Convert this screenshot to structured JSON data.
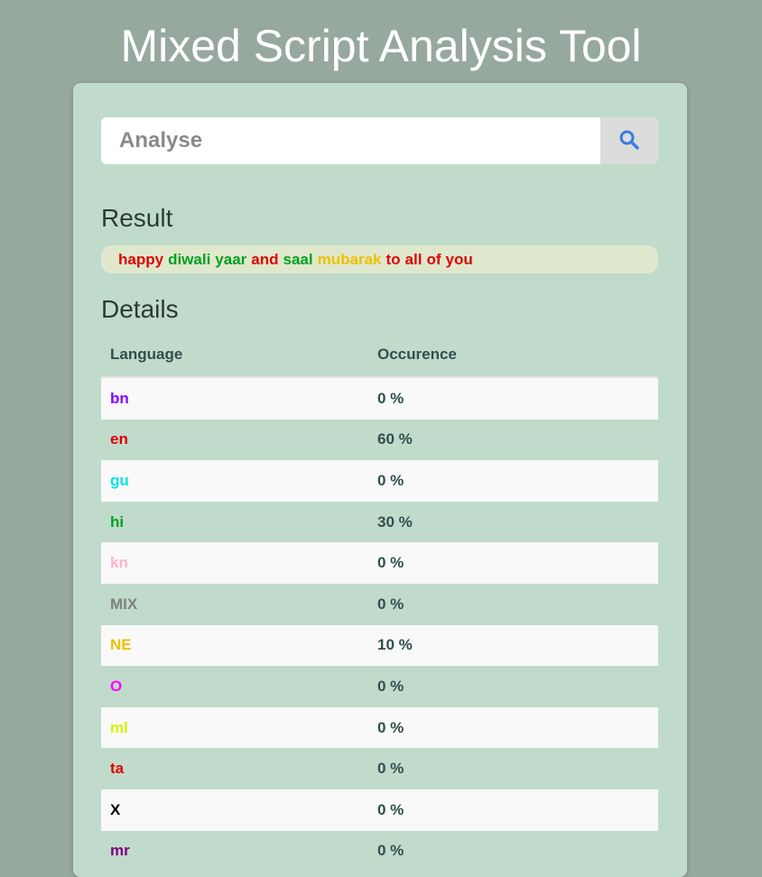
{
  "app": {
    "title": "Mixed Script Analysis Tool"
  },
  "search": {
    "placeholder": "Analyse",
    "value": "",
    "icon": "search-icon",
    "icon_color": "#3b7ddd"
  },
  "result": {
    "heading": "Result",
    "words": [
      {
        "text": "happy",
        "lang": "en",
        "color": "#e00000"
      },
      {
        "text": "diwali",
        "lang": "hi",
        "color": "#00a020"
      },
      {
        "text": "yaar",
        "lang": "hi",
        "color": "#00a020"
      },
      {
        "text": "and",
        "lang": "en",
        "color": "#e00000"
      },
      {
        "text": "saal",
        "lang": "hi",
        "color": "#00a020"
      },
      {
        "text": "mubarak",
        "lang": "NE",
        "color": "#f0c000"
      },
      {
        "text": "to",
        "lang": "en",
        "color": "#e00000"
      },
      {
        "text": "all",
        "lang": "en",
        "color": "#e00000"
      },
      {
        "text": "of",
        "lang": "en",
        "color": "#e00000"
      },
      {
        "text": "you",
        "lang": "en",
        "color": "#e00000"
      }
    ]
  },
  "details": {
    "heading": "Details",
    "columns": [
      "Language",
      "Occurence"
    ],
    "rows": [
      {
        "language": "bn",
        "occurrence": "0 %",
        "color": "#8a00ff"
      },
      {
        "language": "en",
        "occurrence": "60 %",
        "color": "#e00000"
      },
      {
        "language": "gu",
        "occurrence": "0 %",
        "color": "#00e5e5"
      },
      {
        "language": "hi",
        "occurrence": "30 %",
        "color": "#00a020"
      },
      {
        "language": "kn",
        "occurrence": "0 %",
        "color": "#ffb0c8"
      },
      {
        "language": "MIX",
        "occurrence": "0 %",
        "color": "#808080"
      },
      {
        "language": "NE",
        "occurrence": "10 %",
        "color": "#f0c000"
      },
      {
        "language": "O",
        "occurrence": "0 %",
        "color": "#ff00ff"
      },
      {
        "language": "ml",
        "occurrence": "0 %",
        "color": "#d8f000"
      },
      {
        "language": "ta",
        "occurrence": "0 %",
        "color": "#e00000"
      },
      {
        "language": "X",
        "occurrence": "0 %",
        "color": "#000000"
      },
      {
        "language": "mr",
        "occurrence": "0 %",
        "color": "#800080"
      }
    ]
  }
}
